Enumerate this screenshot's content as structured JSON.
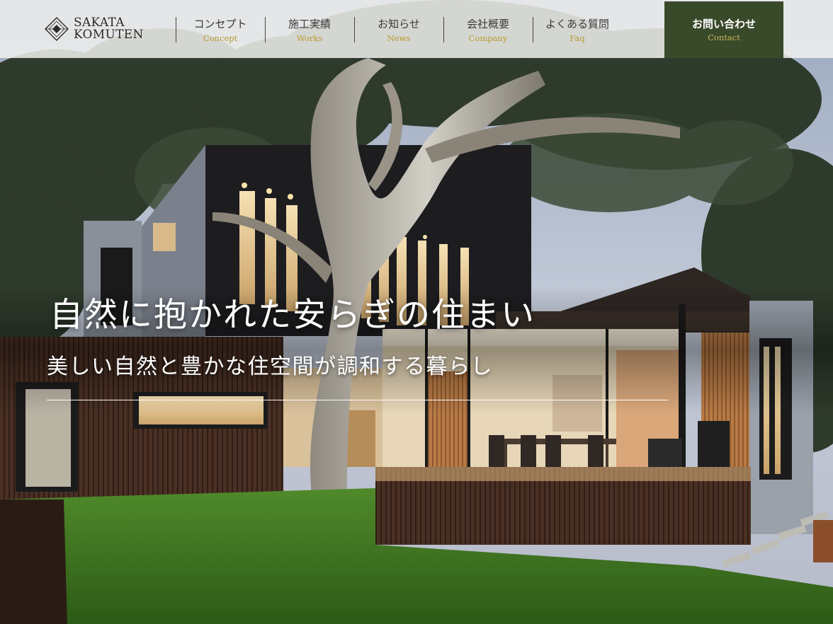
{
  "brand": {
    "line1": "SAKATA",
    "line2": "KOMUTEN",
    "accent_color": "#b89a2a",
    "contact_bg_color": "#394a2a"
  },
  "nav": {
    "items": [
      {
        "jp": "コンセプト",
        "en": "Concept"
      },
      {
        "jp": "施工実績",
        "en": "Works"
      },
      {
        "jp": "お知らせ",
        "en": "News"
      },
      {
        "jp": "会社概要",
        "en": "Company"
      },
      {
        "jp": "よくある質問",
        "en": "Faq"
      }
    ],
    "contact": {
      "jp": "お問い合わせ",
      "en": "Contact"
    }
  },
  "hero": {
    "title": "自然に抱かれた安らぎの住まい",
    "subtitle": "美しい自然と豊かな住空間が調和する暮らし",
    "image_subject": "modern-house-at-dusk-with-tree-and-lawn"
  }
}
